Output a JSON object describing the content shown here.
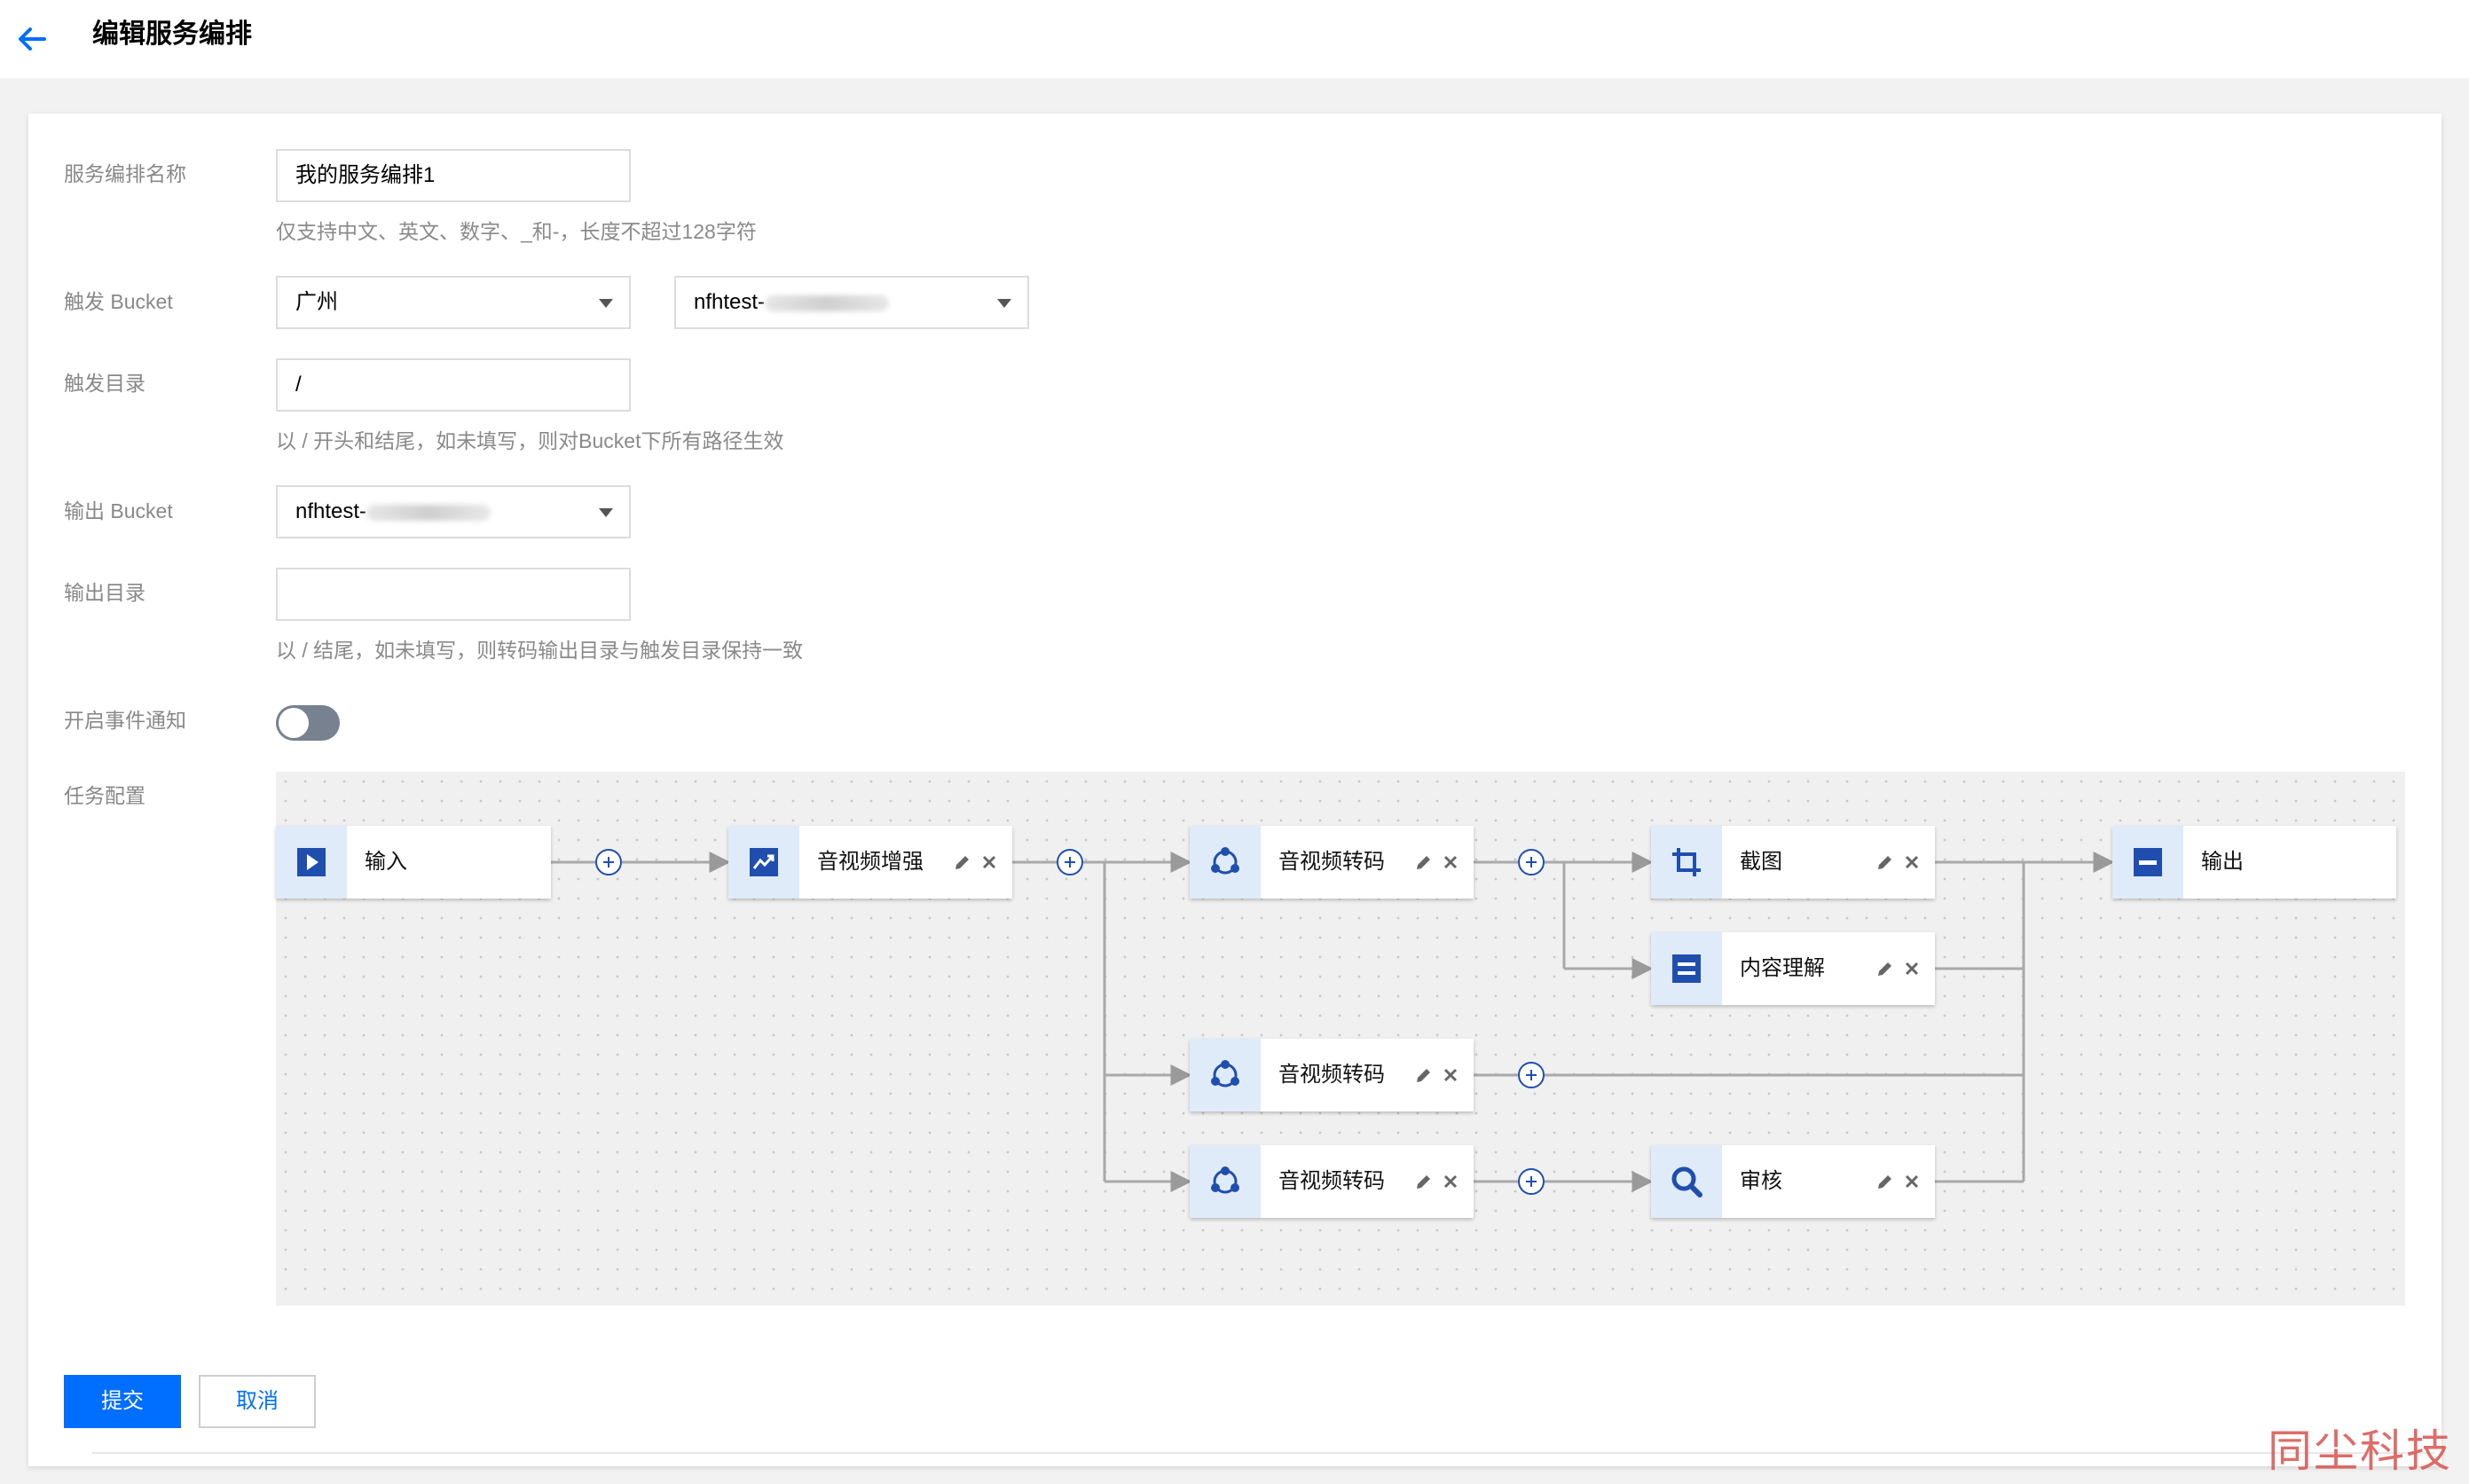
{
  "header": {
    "title": "编辑服务编排"
  },
  "form": {
    "name": {
      "label": "服务编排名称",
      "value": "我的服务编排1",
      "hint": "仅支持中文、英文、数字、_和-，长度不超过128字符"
    },
    "trigger_bucket": {
      "label": "触发 Bucket",
      "region": "广州",
      "bucket": "nfhtest-"
    },
    "trigger_dir": {
      "label": "触发目录",
      "value": "/",
      "hint": "以 / 开头和结尾，如未填写，则对Bucket下所有路径生效"
    },
    "output_bucket": {
      "label": "输出 Bucket",
      "bucket": "nfhtest-"
    },
    "output_dir": {
      "label": "输出目录",
      "value": "",
      "hint": "以 / 结尾，如未填写，则转码输出目录与触发目录保持一致"
    },
    "event_notify": {
      "label": "开启事件通知",
      "enabled": false
    },
    "task_config": {
      "label": "任务配置"
    }
  },
  "workflow": {
    "nodes": [
      {
        "id": "input",
        "label": "输入",
        "icon": "play-icon"
      },
      {
        "id": "enhance",
        "label": "音视频增强",
        "icon": "enhance-icon"
      },
      {
        "id": "transcode1",
        "label": "音视频转码",
        "icon": "transcode-icon"
      },
      {
        "id": "snapshot",
        "label": "截图",
        "icon": "crop-icon"
      },
      {
        "id": "understand",
        "label": "内容理解",
        "icon": "content-icon"
      },
      {
        "id": "output",
        "label": "输出",
        "icon": "output-icon"
      },
      {
        "id": "transcode2",
        "label": "音视频转码",
        "icon": "transcode-icon"
      },
      {
        "id": "transcode3",
        "label": "音视频转码",
        "icon": "transcode-icon"
      },
      {
        "id": "audit",
        "label": "审核",
        "icon": "search-icon"
      }
    ]
  },
  "actions": {
    "submit": "提交",
    "cancel": "取消"
  },
  "watermark": "同尘科技",
  "colors": {
    "primary": "#006eff",
    "node_icon_bg": "#e0ebf9",
    "icon_blue": "#1f4eaf"
  }
}
